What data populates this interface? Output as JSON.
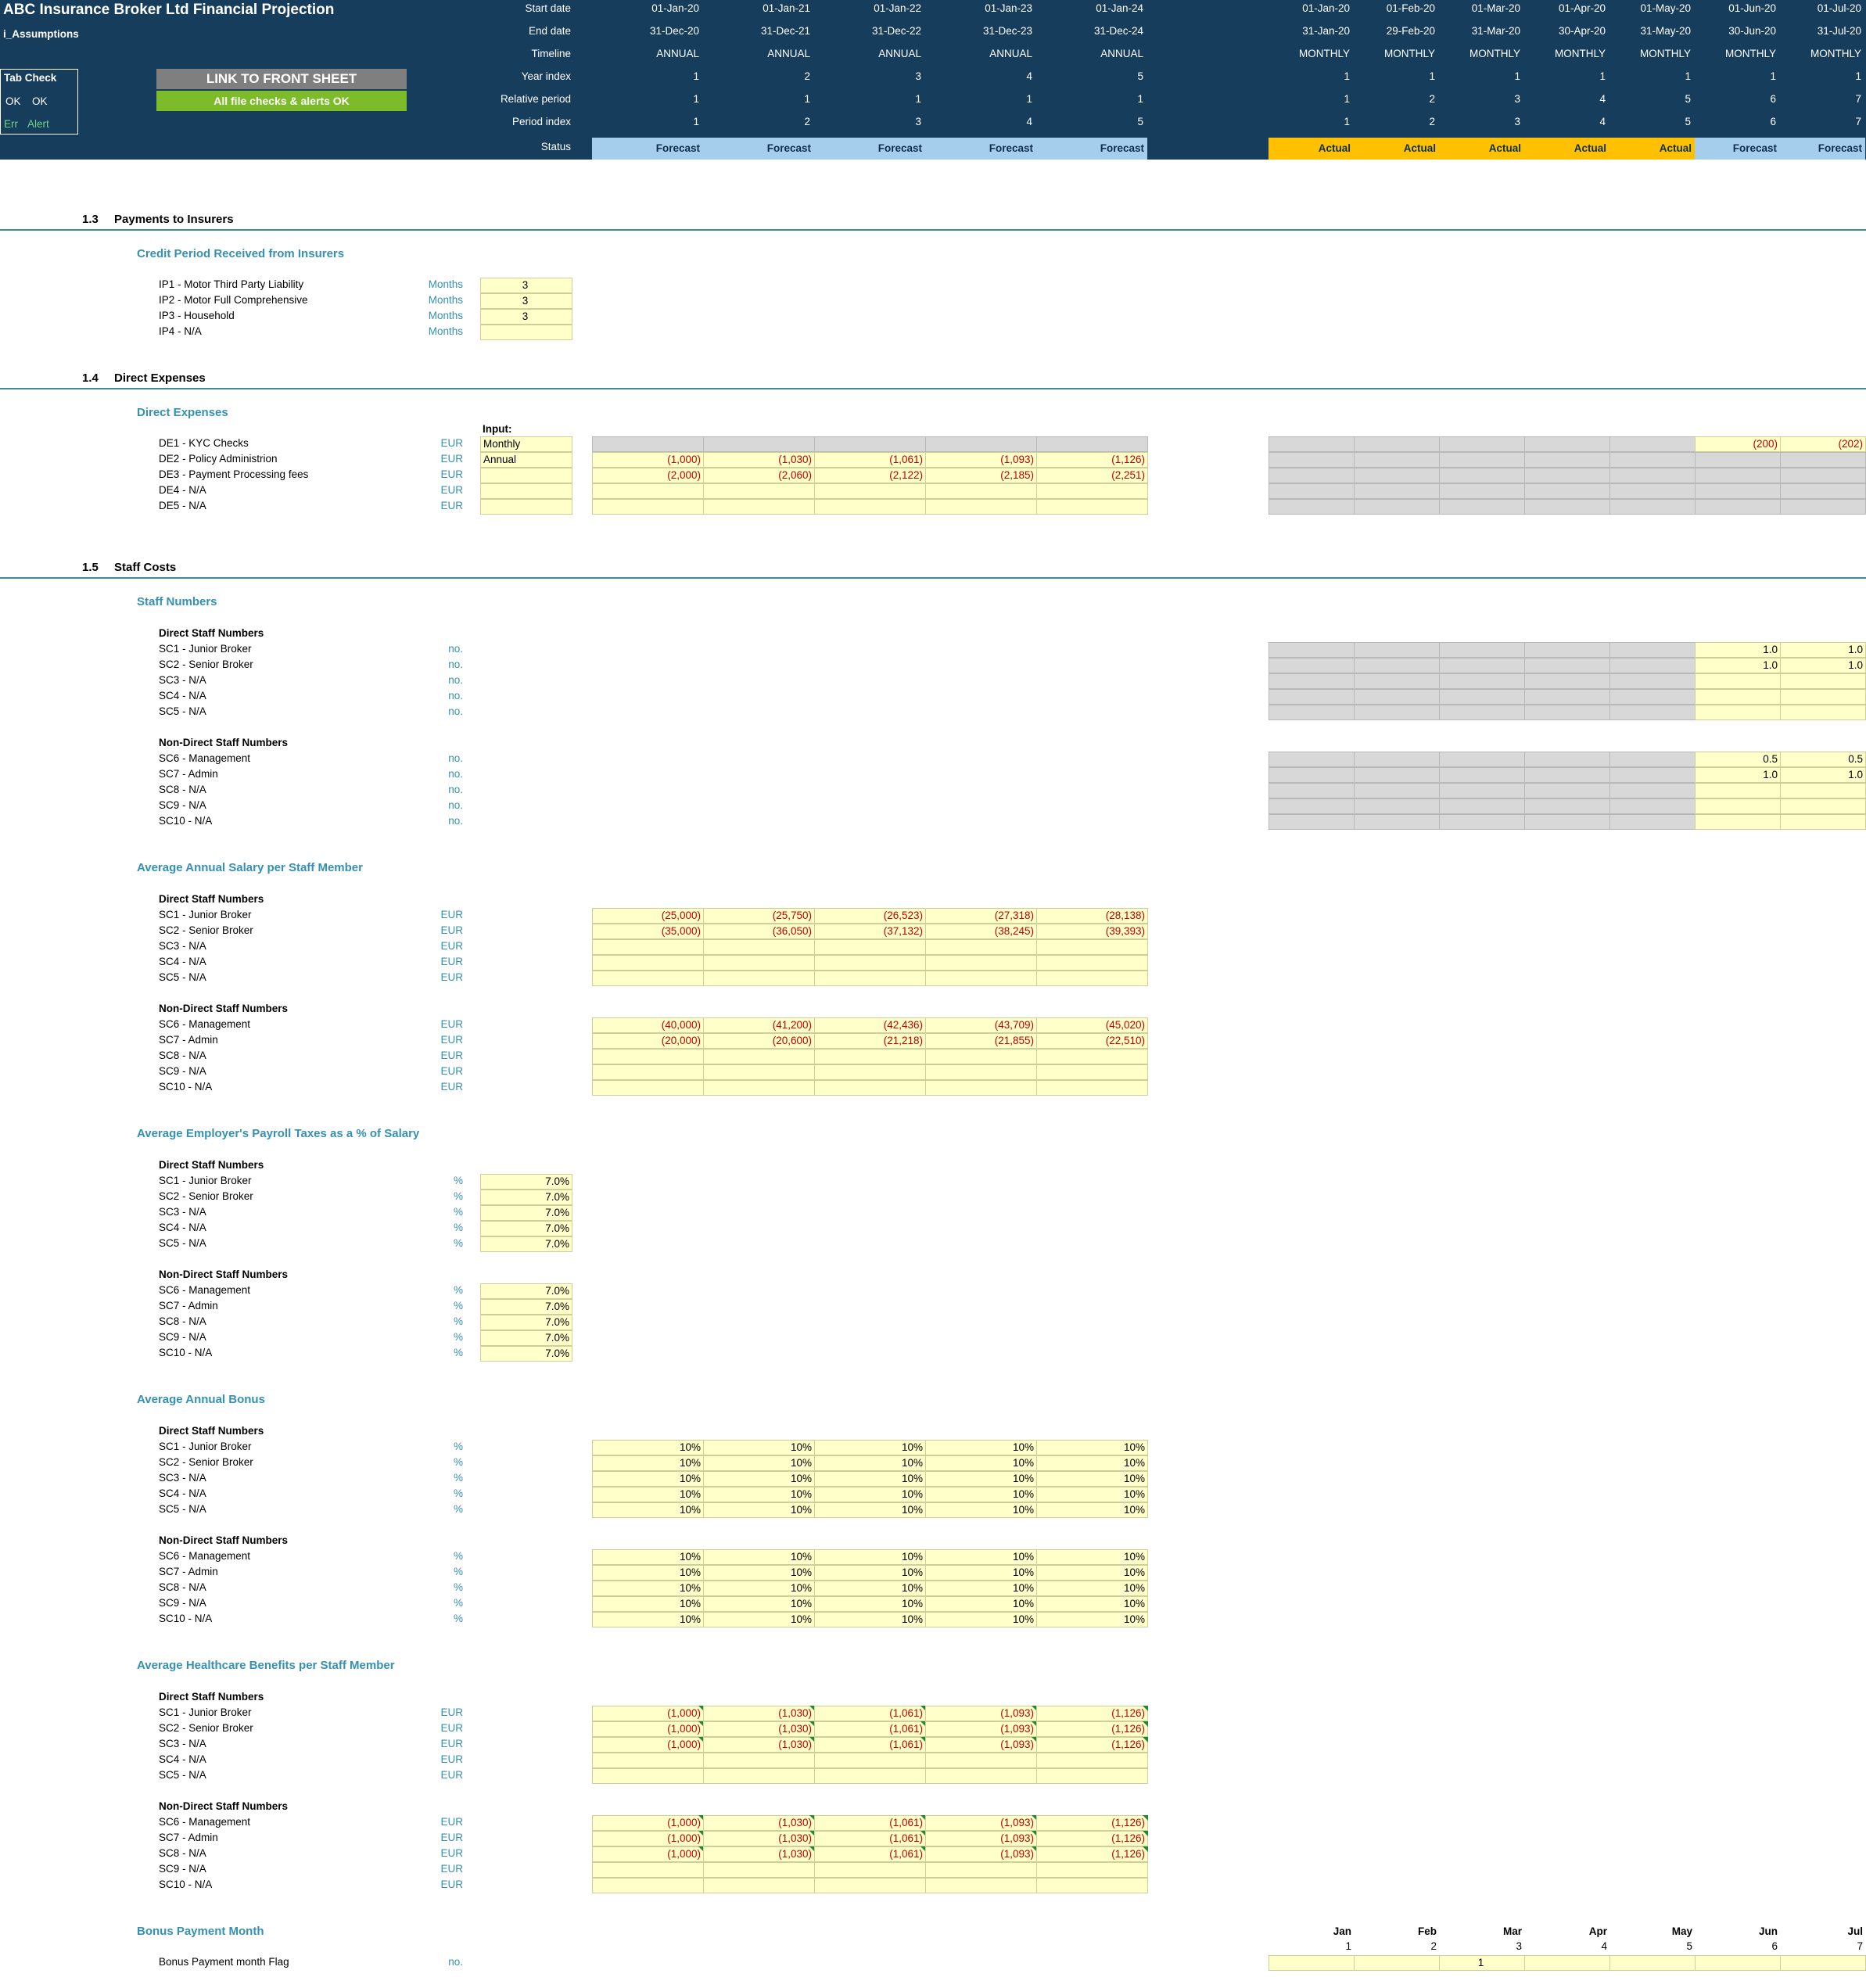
{
  "header": {
    "title": "ABC Insurance Broker Ltd Financial Projection",
    "sheet": "i_Assumptions",
    "row_labels": [
      "Start date",
      "End date",
      "Timeline",
      "Year index",
      "Relative period",
      "Period index",
      "Status"
    ],
    "tab_check": "Tab Check",
    "ok1": "OK",
    "ok2": "OK",
    "err": "Err",
    "alert": "Alert",
    "link_btn": "LINK TO FRONT SHEET",
    "checks_btn": "All file checks & alerts OK"
  },
  "annual_cols": [
    {
      "start": "01-Jan-20",
      "end": "31-Dec-20",
      "timeline": "ANNUAL",
      "year": "1",
      "rel": "1",
      "idx": "1",
      "status": "Forecast"
    },
    {
      "start": "01-Jan-21",
      "end": "31-Dec-21",
      "timeline": "ANNUAL",
      "year": "2",
      "rel": "1",
      "idx": "2",
      "status": "Forecast"
    },
    {
      "start": "01-Jan-22",
      "end": "31-Dec-22",
      "timeline": "ANNUAL",
      "year": "3",
      "rel": "1",
      "idx": "3",
      "status": "Forecast"
    },
    {
      "start": "01-Jan-23",
      "end": "31-Dec-23",
      "timeline": "ANNUAL",
      "year": "4",
      "rel": "1",
      "idx": "4",
      "status": "Forecast"
    },
    {
      "start": "01-Jan-24",
      "end": "31-Dec-24",
      "timeline": "ANNUAL",
      "year": "5",
      "rel": "1",
      "idx": "5",
      "status": "Forecast"
    }
  ],
  "monthly_cols": [
    {
      "start": "01-Jan-20",
      "end": "31-Jan-20",
      "timeline": "MONTHLY",
      "year": "1",
      "rel": "1",
      "idx": "1",
      "status": "Actual"
    },
    {
      "start": "01-Feb-20",
      "end": "29-Feb-20",
      "timeline": "MONTHLY",
      "year": "1",
      "rel": "2",
      "idx": "2",
      "status": "Actual"
    },
    {
      "start": "01-Mar-20",
      "end": "31-Mar-20",
      "timeline": "MONTHLY",
      "year": "1",
      "rel": "3",
      "idx": "3",
      "status": "Actual"
    },
    {
      "start": "01-Apr-20",
      "end": "30-Apr-20",
      "timeline": "MONTHLY",
      "year": "1",
      "rel": "4",
      "idx": "4",
      "status": "Actual"
    },
    {
      "start": "01-May-20",
      "end": "31-May-20",
      "timeline": "MONTHLY",
      "year": "1",
      "rel": "5",
      "idx": "5",
      "status": "Actual"
    },
    {
      "start": "01-Jun-20",
      "end": "30-Jun-20",
      "timeline": "MONTHLY",
      "year": "1",
      "rel": "6",
      "idx": "6",
      "status": "Forecast"
    },
    {
      "start": "01-Jul-20",
      "end": "31-Jul-20",
      "timeline": "MONTHLY",
      "year": "1",
      "rel": "7",
      "idx": "7",
      "status": "Forecast"
    }
  ],
  "s13": {
    "num": "1.3",
    "title": "Payments to Insurers",
    "sub": "Credit Period Received from Insurers",
    "rows": [
      {
        "label": "IP1 - Motor Third Party Liability",
        "unit": "Months",
        "val": "3"
      },
      {
        "label": "IP2 - Motor Full Comprehensive",
        "unit": "Months",
        "val": "3"
      },
      {
        "label": "IP3 - Household",
        "unit": "Months",
        "val": "3"
      },
      {
        "label": "IP4 - N/A",
        "unit": "Months",
        "val": ""
      }
    ]
  },
  "s14": {
    "num": "1.4",
    "title": "Direct Expenses",
    "sub": "Direct Expenses",
    "input_hdr": "Input:",
    "rows": [
      {
        "label": "DE1 - KYC Checks",
        "unit": "EUR",
        "input": "Monthly",
        "annual": [
          "",
          "",
          "",
          "",
          ""
        ],
        "monthly": [
          "",
          "",
          "",
          "",
          "",
          "(200)",
          "(202)"
        ]
      },
      {
        "label": "DE2 - Policy Administrion",
        "unit": "EUR",
        "input": "Annual",
        "annual": [
          "(1,000)",
          "(1,030)",
          "(1,061)",
          "(1,093)",
          "(1,126)"
        ],
        "monthly": [
          "",
          "",
          "",
          "",
          "",
          "",
          ""
        ]
      },
      {
        "label": "DE3 - Payment Processing fees",
        "unit": "EUR",
        "input": "",
        "annual": [
          "(2,000)",
          "(2,060)",
          "(2,122)",
          "(2,185)",
          "(2,251)"
        ],
        "monthly": [
          "",
          "",
          "",
          "",
          "",
          "",
          ""
        ]
      },
      {
        "label": "DE4 - N/A",
        "unit": "EUR",
        "input": "",
        "annual": [
          "",
          "",
          "",
          "",
          ""
        ],
        "monthly": [
          "",
          "",
          "",
          "",
          "",
          "",
          ""
        ]
      },
      {
        "label": "DE5 - N/A",
        "unit": "EUR",
        "input": "",
        "annual": [
          "",
          "",
          "",
          "",
          ""
        ],
        "monthly": [
          "",
          "",
          "",
          "",
          "",
          "",
          ""
        ]
      }
    ]
  },
  "s15": {
    "num": "1.5",
    "title": "Staff Costs",
    "staff_numbers": {
      "sub": "Staff Numbers",
      "direct_hdr": "Direct Staff Numbers",
      "nondirect_hdr": "Non-Direct Staff Numbers",
      "direct": [
        {
          "label": "SC1 - Junior Broker",
          "unit": "no.",
          "m": [
            "1.0",
            "1.0"
          ]
        },
        {
          "label": "SC2 - Senior Broker",
          "unit": "no.",
          "m": [
            "1.0",
            "1.0"
          ]
        },
        {
          "label": "SC3 - N/A",
          "unit": "no.",
          "m": [
            "",
            ""
          ]
        },
        {
          "label": "SC4 - N/A",
          "unit": "no.",
          "m": [
            "",
            ""
          ]
        },
        {
          "label": "SC5 - N/A",
          "unit": "no.",
          "m": [
            "",
            ""
          ]
        }
      ],
      "nondirect": [
        {
          "label": "SC6 - Management",
          "unit": "no.",
          "m": [
            "0.5",
            "0.5"
          ]
        },
        {
          "label": "SC7 - Admin",
          "unit": "no.",
          "m": [
            "1.0",
            "1.0"
          ]
        },
        {
          "label": "SC8 - N/A",
          "unit": "no.",
          "m": [
            "",
            ""
          ]
        },
        {
          "label": "SC9 - N/A",
          "unit": "no.",
          "m": [
            "",
            ""
          ]
        },
        {
          "label": "SC10 - N/A",
          "unit": "no.",
          "m": [
            "",
            ""
          ]
        }
      ]
    },
    "salary": {
      "sub": "Average Annual Salary per Staff Member",
      "direct_hdr": "Direct Staff Numbers",
      "nondirect_hdr": "Non-Direct Staff Numbers",
      "direct": [
        {
          "label": "SC1 - Junior Broker",
          "unit": "EUR",
          "v": [
            "(25,000)",
            "(25,750)",
            "(26,523)",
            "(27,318)",
            "(28,138)"
          ]
        },
        {
          "label": "SC2 - Senior Broker",
          "unit": "EUR",
          "v": [
            "(35,000)",
            "(36,050)",
            "(37,132)",
            "(38,245)",
            "(39,393)"
          ]
        },
        {
          "label": "SC3 - N/A",
          "unit": "EUR",
          "v": [
            "",
            "",
            "",
            "",
            ""
          ]
        },
        {
          "label": "SC4 - N/A",
          "unit": "EUR",
          "v": [
            "",
            "",
            "",
            "",
            ""
          ]
        },
        {
          "label": "SC5 - N/A",
          "unit": "EUR",
          "v": [
            "",
            "",
            "",
            "",
            ""
          ]
        }
      ],
      "nondirect": [
        {
          "label": "SC6 - Management",
          "unit": "EUR",
          "v": [
            "(40,000)",
            "(41,200)",
            "(42,436)",
            "(43,709)",
            "(45,020)"
          ]
        },
        {
          "label": "SC7 - Admin",
          "unit": "EUR",
          "v": [
            "(20,000)",
            "(20,600)",
            "(21,218)",
            "(21,855)",
            "(22,510)"
          ]
        },
        {
          "label": "SC8 - N/A",
          "unit": "EUR",
          "v": [
            "",
            "",
            "",
            "",
            ""
          ]
        },
        {
          "label": "SC9 - N/A",
          "unit": "EUR",
          "v": [
            "",
            "",
            "",
            "",
            ""
          ]
        },
        {
          "label": "SC10 - N/A",
          "unit": "EUR",
          "v": [
            "",
            "",
            "",
            "",
            ""
          ]
        }
      ]
    },
    "payroll": {
      "sub": "Average Employer's Payroll Taxes as a % of Salary",
      "direct_hdr": "Direct Staff Numbers",
      "nondirect_hdr": "Non-Direct Staff Numbers",
      "direct": [
        {
          "label": "SC1 - Junior Broker",
          "unit": "%",
          "val": "7.0%"
        },
        {
          "label": "SC2 - Senior Broker",
          "unit": "%",
          "val": "7.0%"
        },
        {
          "label": "SC3 - N/A",
          "unit": "%",
          "val": "7.0%"
        },
        {
          "label": "SC4 - N/A",
          "unit": "%",
          "val": "7.0%"
        },
        {
          "label": "SC5 - N/A",
          "unit": "%",
          "val": "7.0%"
        }
      ],
      "nondirect": [
        {
          "label": "SC6 - Management",
          "unit": "%",
          "val": "7.0%"
        },
        {
          "label": "SC7 - Admin",
          "unit": "%",
          "val": "7.0%"
        },
        {
          "label": "SC8 - N/A",
          "unit": "%",
          "val": "7.0%"
        },
        {
          "label": "SC9 - N/A",
          "unit": "%",
          "val": "7.0%"
        },
        {
          "label": "SC10 - N/A",
          "unit": "%",
          "val": "7.0%"
        }
      ]
    },
    "bonus": {
      "sub": "Average Annual Bonus",
      "direct_hdr": "Direct Staff Numbers",
      "nondirect_hdr": "Non-Direct Staff Numbers",
      "direct": [
        {
          "label": "SC1 - Junior Broker",
          "unit": "%",
          "v": [
            "10%",
            "10%",
            "10%",
            "10%",
            "10%"
          ]
        },
        {
          "label": "SC2 - Senior Broker",
          "unit": "%",
          "v": [
            "10%",
            "10%",
            "10%",
            "10%",
            "10%"
          ]
        },
        {
          "label": "SC3 - N/A",
          "unit": "%",
          "v": [
            "10%",
            "10%",
            "10%",
            "10%",
            "10%"
          ]
        },
        {
          "label": "SC4 - N/A",
          "unit": "%",
          "v": [
            "10%",
            "10%",
            "10%",
            "10%",
            "10%"
          ]
        },
        {
          "label": "SC5 - N/A",
          "unit": "%",
          "v": [
            "10%",
            "10%",
            "10%",
            "10%",
            "10%"
          ]
        }
      ],
      "nondirect": [
        {
          "label": "SC6 - Management",
          "unit": "%",
          "v": [
            "10%",
            "10%",
            "10%",
            "10%",
            "10%"
          ]
        },
        {
          "label": "SC7 - Admin",
          "unit": "%",
          "v": [
            "10%",
            "10%",
            "10%",
            "10%",
            "10%"
          ]
        },
        {
          "label": "SC8 - N/A",
          "unit": "%",
          "v": [
            "10%",
            "10%",
            "10%",
            "10%",
            "10%"
          ]
        },
        {
          "label": "SC9 - N/A",
          "unit": "%",
          "v": [
            "10%",
            "10%",
            "10%",
            "10%",
            "10%"
          ]
        },
        {
          "label": "SC10 - N/A",
          "unit": "%",
          "v": [
            "10%",
            "10%",
            "10%",
            "10%",
            "10%"
          ]
        }
      ]
    },
    "health": {
      "sub": "Average Healthcare Benefits per Staff Member",
      "direct_hdr": "Direct Staff Numbers",
      "nondirect_hdr": "Non-Direct Staff Numbers",
      "direct": [
        {
          "label": "SC1 - Junior Broker",
          "unit": "EUR",
          "v": [
            "(1,000)",
            "(1,030)",
            "(1,061)",
            "(1,093)",
            "(1,126)"
          ]
        },
        {
          "label": "SC2 - Senior Broker",
          "unit": "EUR",
          "v": [
            "(1,000)",
            "(1,030)",
            "(1,061)",
            "(1,093)",
            "(1,126)"
          ]
        },
        {
          "label": "SC3 - N/A",
          "unit": "EUR",
          "v": [
            "(1,000)",
            "(1,030)",
            "(1,061)",
            "(1,093)",
            "(1,126)"
          ]
        },
        {
          "label": "SC4 - N/A",
          "unit": "EUR",
          "v": [
            "",
            "",
            "",
            "",
            ""
          ]
        },
        {
          "label": "SC5 - N/A",
          "unit": "EUR",
          "v": [
            "",
            "",
            "",
            "",
            ""
          ]
        }
      ],
      "nondirect": [
        {
          "label": "SC6 - Management",
          "unit": "EUR",
          "v": [
            "(1,000)",
            "(1,030)",
            "(1,061)",
            "(1,093)",
            "(1,126)"
          ]
        },
        {
          "label": "SC7 - Admin",
          "unit": "EUR",
          "v": [
            "(1,000)",
            "(1,030)",
            "(1,061)",
            "(1,093)",
            "(1,126)"
          ]
        },
        {
          "label": "SC8 - N/A",
          "unit": "EUR",
          "v": [
            "(1,000)",
            "(1,030)",
            "(1,061)",
            "(1,093)",
            "(1,126)"
          ]
        },
        {
          "label": "SC9 - N/A",
          "unit": "EUR",
          "v": [
            "",
            "",
            "",
            "",
            ""
          ]
        },
        {
          "label": "SC10 - N/A",
          "unit": "EUR",
          "v": [
            "",
            "",
            "",
            "",
            ""
          ]
        }
      ]
    },
    "bonus_month": {
      "sub": "Bonus Payment Month",
      "label": "Bonus Payment month Flag",
      "unit": "no.",
      "months": [
        "Jan",
        "Feb",
        "Mar",
        "Apr",
        "May",
        "Jun",
        "Jul"
      ],
      "nums": [
        "1",
        "2",
        "3",
        "4",
        "5",
        "6",
        "7"
      ],
      "flags": [
        "",
        "",
        "1",
        "",
        "",
        "",
        ""
      ]
    }
  },
  "colors": {
    "header_bg": "#173d5c",
    "forecast": "#a5cdec",
    "actual": "#ffc000",
    "input_cell": "#ffffc9",
    "negative": "#c00000",
    "accent": "#3590b2"
  }
}
